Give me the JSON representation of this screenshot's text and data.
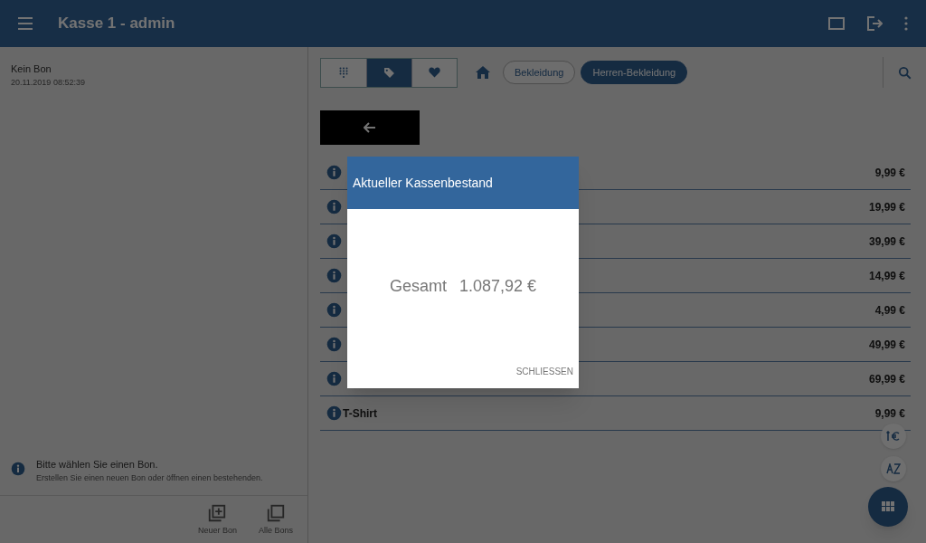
{
  "header": {
    "title": "Kasse 1 - admin"
  },
  "bon": {
    "title": "Kein Bon",
    "date": "20.11.2019 08:52:39"
  },
  "modes": [
    {
      "kind": "keypad",
      "selected": false
    },
    {
      "kind": "tag",
      "selected": true
    },
    {
      "kind": "favorite",
      "selected": false
    }
  ],
  "breadcrumbs": [
    {
      "label": "Bekleidung",
      "selected": false
    },
    {
      "label": "Herren-Bekleidung",
      "selected": true
    }
  ],
  "products": [
    {
      "price": "9,99 €"
    },
    {
      "price": "19,99 €"
    },
    {
      "price": "39,99 €"
    },
    {
      "price": "14,99 €"
    },
    {
      "price": "4,99 €"
    },
    {
      "price": "49,99 €"
    },
    {
      "price": "69,99 €"
    },
    {
      "name": "T-Shirt",
      "price": "9,99 €"
    }
  ],
  "message": {
    "title": "Bitte wählen Sie einen Bon.",
    "text": "Erstellen Sie einen neuen Bon oder öffnen einen bestehenden."
  },
  "actions": [
    {
      "kind": "new",
      "label": "Neuer Bon"
    },
    {
      "kind": "all",
      "label": "Alle Bons"
    }
  ],
  "dialog": {
    "title": "Aktueller Kassenbestand",
    "label": "Gesamt",
    "amount": "1.087,92 €",
    "button": "SCHLIESSEN"
  }
}
